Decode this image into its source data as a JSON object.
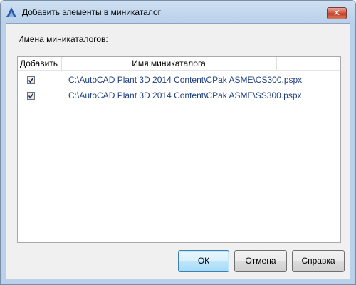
{
  "window": {
    "title": "Добавить элементы в миникаталог",
    "close_glyph": "✕",
    "icon": "autocad-a-icon"
  },
  "content": {
    "list_label": "Имена миникаталогов:",
    "columns": [
      "Добавить",
      "Имя миникаталога"
    ],
    "rows": [
      {
        "checked": true,
        "path": "C:\\AutoCAD Plant 3D 2014 Content\\CPak ASME\\CS300.pspx"
      },
      {
        "checked": true,
        "path": "C:\\AutoCAD Plant 3D 2014 Content\\CPak ASME\\SS300.pspx"
      }
    ]
  },
  "buttons": {
    "ok": "ОК",
    "cancel": "Отмена",
    "help": "Справка"
  },
  "colors": {
    "path_text": "#1f3f7f",
    "titlebar": "#b9d1ea",
    "close_button": "#c23c24"
  }
}
